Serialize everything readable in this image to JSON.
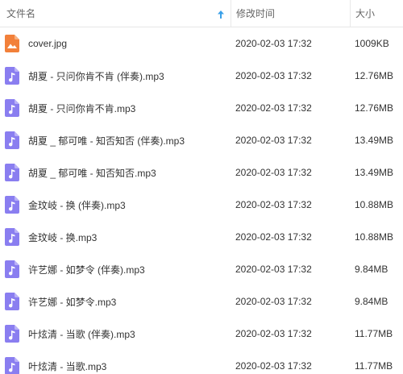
{
  "header": {
    "name_label": "文件名",
    "date_label": "修改时间",
    "size_label": "大小"
  },
  "colors": {
    "image_icon": "#f2803a",
    "audio_icon": "#8a7ef0",
    "sort_arrow": "#3aa0e8"
  },
  "files": [
    {
      "name": "cover.jpg",
      "modified": "2020-02-03 17:32",
      "size": "1009KB",
      "icon": "image-icon"
    },
    {
      "name": "胡夏 - 只问你肯不肯 (伴奏).mp3",
      "modified": "2020-02-03 17:32",
      "size": "12.76MB",
      "icon": "music-file-icon"
    },
    {
      "name": "胡夏 - 只问你肯不肯.mp3",
      "modified": "2020-02-03 17:32",
      "size": "12.76MB",
      "icon": "music-file-icon"
    },
    {
      "name": "胡夏 _ 郁可唯 - 知否知否 (伴奏).mp3",
      "modified": "2020-02-03 17:32",
      "size": "13.49MB",
      "icon": "music-file-icon"
    },
    {
      "name": "胡夏 _ 郁可唯 - 知否知否.mp3",
      "modified": "2020-02-03 17:32",
      "size": "13.49MB",
      "icon": "music-file-icon"
    },
    {
      "name": "金玟岐 - 换 (伴奏).mp3",
      "modified": "2020-02-03 17:32",
      "size": "10.88MB",
      "icon": "music-file-icon"
    },
    {
      "name": "金玟岐 - 换.mp3",
      "modified": "2020-02-03 17:32",
      "size": "10.88MB",
      "icon": "music-file-icon"
    },
    {
      "name": "许艺娜 - 如梦令 (伴奏).mp3",
      "modified": "2020-02-03 17:32",
      "size": "9.84MB",
      "icon": "music-file-icon"
    },
    {
      "name": "许艺娜 - 如梦令.mp3",
      "modified": "2020-02-03 17:32",
      "size": "9.84MB",
      "icon": "music-file-icon"
    },
    {
      "name": "叶炫清 - 当歌 (伴奏).mp3",
      "modified": "2020-02-03 17:32",
      "size": "11.77MB",
      "icon": "music-file-icon"
    },
    {
      "name": "叶炫清 - 当歌.mp3",
      "modified": "2020-02-03 17:32",
      "size": "11.77MB",
      "icon": "music-file-icon"
    }
  ]
}
